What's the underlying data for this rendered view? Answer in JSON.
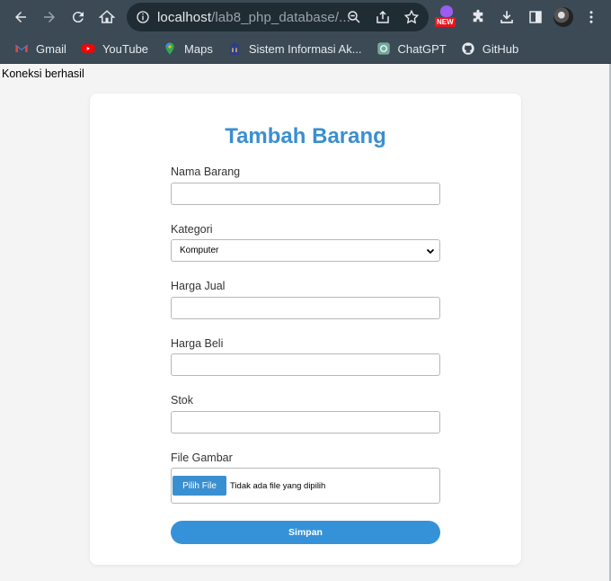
{
  "browser": {
    "url_host": "localhost",
    "url_path": "/lab8_php_database/...",
    "ext_badge": "NEW",
    "bookmarks": [
      {
        "label": "Gmail",
        "icon": "gmail-icon"
      },
      {
        "label": "YouTube",
        "icon": "youtube-icon"
      },
      {
        "label": "Maps",
        "icon": "maps-icon"
      },
      {
        "label": "Sistem Informasi Ak...",
        "icon": "university-icon"
      },
      {
        "label": "ChatGPT",
        "icon": "chatgpt-icon"
      },
      {
        "label": "GitHub",
        "icon": "github-icon"
      }
    ]
  },
  "page": {
    "connection_status": "Koneksi berhasil"
  },
  "form": {
    "title": "Tambah Barang",
    "nama_label": "Nama Barang",
    "nama_value": "",
    "kategori_label": "Kategori",
    "kategori_value": "Komputer",
    "harga_jual_label": "Harga Jual",
    "harga_jual_value": "",
    "harga_beli_label": "Harga Beli",
    "harga_beli_value": "",
    "stok_label": "Stok",
    "stok_value": "",
    "gambar_label": "File Gambar",
    "file_button": "Pilih File",
    "file_status": "Tidak ada file yang dipilih",
    "submit_label": "Simpan"
  },
  "colors": {
    "accent": "#3a8fd0",
    "chrome": "#3b4a55"
  }
}
